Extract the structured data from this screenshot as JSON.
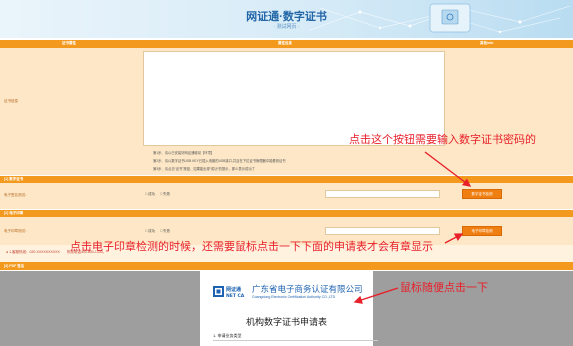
{
  "header": {
    "title": "网证通·数字证书",
    "subtitle": "· 测试网页 ·"
  },
  "columns": {
    "col1": "证书属性",
    "col2": "属性信息",
    "col3": "其他info"
  },
  "cert_info": {
    "label": "证书信息",
    "steps": [
      "第1步、请以已安装好网证通驱动【环境】",
      "第2步、请以数字证书USB KEY已插入电脑的USB接口,并且在下拉证书管理器中能看到证书",
      "第3步、请点击“证书”按钮，如果能出现“成功”的提示，那么表示成功了"
    ]
  },
  "digital_cert": {
    "section_title": "[1] 数字证书",
    "row_label": "电子签名测试：",
    "radio_success": "成功",
    "radio_fail": "失败",
    "button": "数字证书检测"
  },
  "seal": {
    "section_title": "[2] 电子印章",
    "row_label": "电子印章测试：",
    "radio_success": "成功",
    "radio_fail": "失败",
    "button": "电子印章检测"
  },
  "hotline": "● 1.客服热线：020-XXXXXXXXXX　　热线电话400-830-1330。",
  "pdf": {
    "section_title": "[3] PDF 签名",
    "company_cn": "广东省电子商务认证有限公司",
    "company_en": "Guangdong Electronic Certification Authority CO.,LTD",
    "logo_cn": "网证通",
    "logo_en": "NET CA",
    "form_title": "机构数字证书申请表",
    "section1": "1. 申请业务类型"
  },
  "annotations": {
    "note1": "点击这个按钮需要输入数字证书密码的",
    "note2": "点击电子印章检测的时候，还需要鼠标点击一下下面的申请表才会有章显示",
    "note3": "鼠标随便点击一下"
  },
  "colors": {
    "orange": "#f39a1e",
    "annotation_red": "#e8202a",
    "brand_blue": "#1d62b0"
  }
}
